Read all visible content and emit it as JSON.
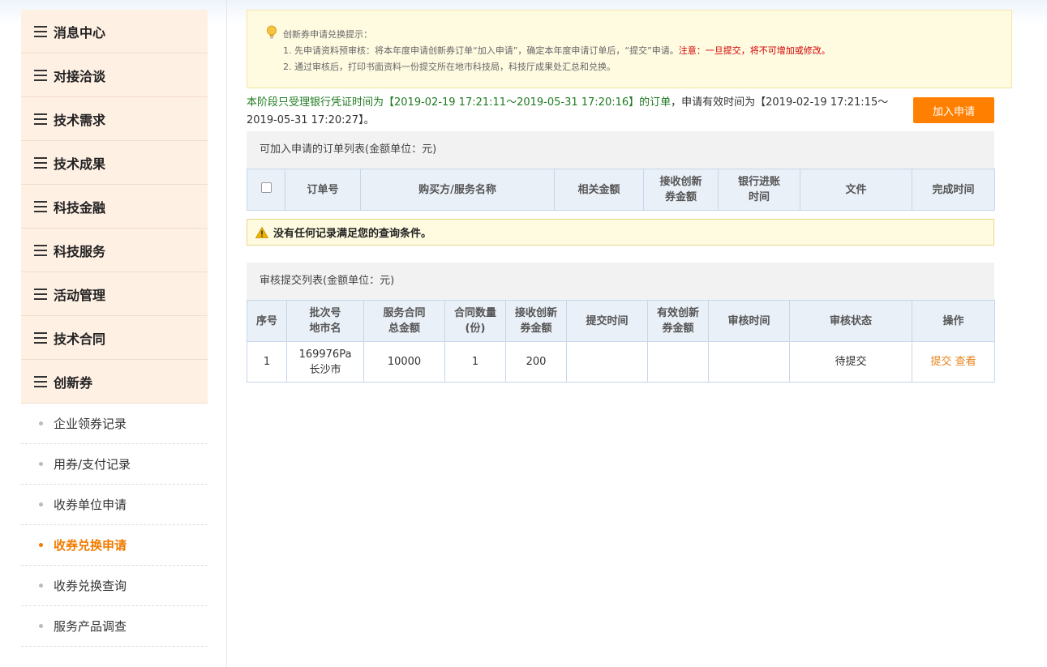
{
  "sidebar": {
    "menu": [
      {
        "label": "消息中心"
      },
      {
        "label": "对接洽谈"
      },
      {
        "label": "技术需求"
      },
      {
        "label": "技术成果"
      },
      {
        "label": "科技金融"
      },
      {
        "label": "科技服务"
      },
      {
        "label": "活动管理"
      },
      {
        "label": "技术合同"
      },
      {
        "label": "创新券"
      }
    ],
    "sub": [
      {
        "label": "企业领券记录"
      },
      {
        "label": "用券/支付记录"
      },
      {
        "label": "收券单位申请"
      },
      {
        "label": "收券兑换申请",
        "active": true
      },
      {
        "label": "收券兑换查询"
      },
      {
        "label": "服务产品调查"
      }
    ]
  },
  "tip": {
    "title": "创新券申请兑换提示：",
    "line1": "1. 先申请资料预审核：将本年度申请创新券订单“加入申请”，确定本年度申请订单后，“提交”申请。",
    "line1_warn": "注意：一旦提交，将不可增加或修改。",
    "line2": "2. 通过审核后，打印书面资料一份提交所在地市科技局，科技厅成果处汇总和兑换。"
  },
  "period": {
    "green_text": "本阶段只受理银行凭证时间为【2019-02-19 17:21:11～2019-05-31 17:20:16】的订单",
    "rest_text": "，申请有效时间为【2019-02-19 17:21:15～2019-05-31 17:20:27】。"
  },
  "add_button": "加入申请",
  "orders": {
    "heading": "可加入申请的订单列表(金额单位：元)",
    "columns": [
      "订单号",
      "购买方/服务名称",
      "相关金额",
      "接收创新券金额",
      "银行进账时间",
      "文件",
      "完成时间"
    ],
    "empty_message": "没有任何记录满足您的查询条件。"
  },
  "review": {
    "heading": "审核提交列表(金额单位：元)",
    "columns": {
      "seq": "序号",
      "batch_a": "批次号",
      "batch_b": "地市名",
      "contract_a": "服务合同",
      "contract_b": "总金额",
      "qty_a": "合同数量",
      "qty_b": "(份)",
      "recv_a": "接收创新",
      "recv_b": "券金额",
      "submit_time": "提交时间",
      "valid_a": "有效创新",
      "valid_b": "券金额",
      "review_time": "审核时间",
      "status": "审核状态",
      "ops": "操作"
    },
    "rows": [
      {
        "seq": "1",
        "batch": "169976Pa",
        "city": "长沙市",
        "contract_total": "10000",
        "qty": "1",
        "recv": "200",
        "submit_time": "",
        "valid": "",
        "review_time": "",
        "status": "待提交",
        "op_submit": "提交",
        "op_view": "查看"
      }
    ]
  },
  "colors": {
    "accent": "#ff8000",
    "menu_bg": "#fff0e4",
    "table_head": "#eaf0f8",
    "tip_bg": "#fffbe1",
    "green": "#1f7a1f",
    "warn_red": "#d10000"
  }
}
